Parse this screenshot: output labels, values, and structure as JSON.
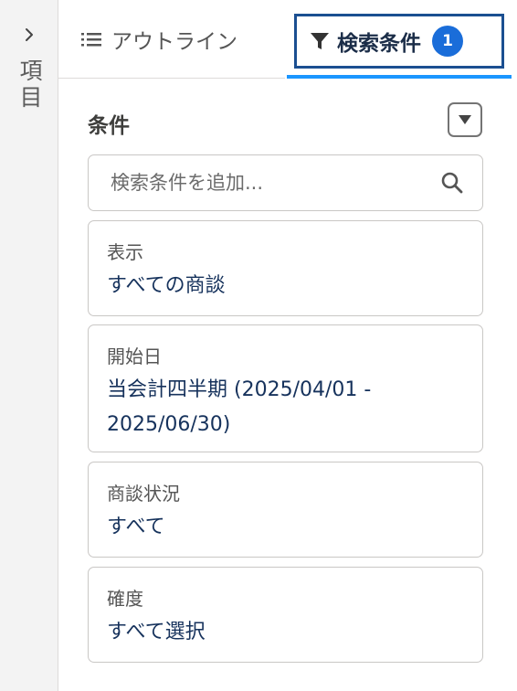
{
  "rail": {
    "label": "項目"
  },
  "tabs": {
    "outline_label": "アウトライン",
    "search_label": "検索条件",
    "search_badge": "1"
  },
  "conditions": {
    "header": "条件",
    "search_placeholder": "検索条件を追加...",
    "filters": [
      {
        "label": "表示",
        "value": "すべての商談"
      },
      {
        "label": "開始日",
        "value": "当会計四半期 (2025/04/01 - 2025/06/30)"
      },
      {
        "label": "商談状況",
        "value": "すべて"
      },
      {
        "label": "確度",
        "value": "すべて選択"
      }
    ]
  },
  "colors": {
    "accent": "#1b96ff",
    "active_frame": "#1b4f91",
    "badge": "#1a6dd9",
    "value_text": "#16325c"
  }
}
